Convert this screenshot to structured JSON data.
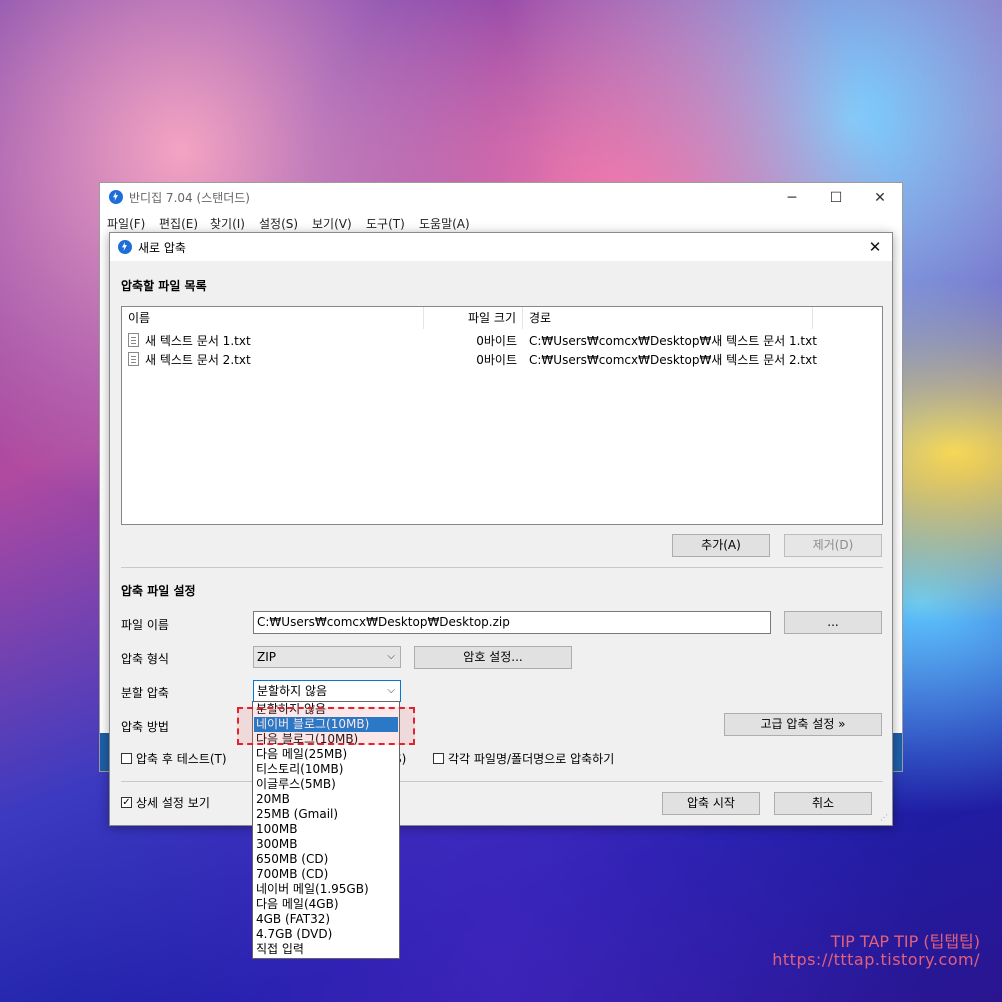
{
  "watermark": {
    "line1": "TIP TAP TIP (팁탭팁)",
    "line2": "https://tttap.tistory.com/"
  },
  "main_window": {
    "title": "반디집 7.04 (스탠더드)",
    "controls": {
      "minimize": "─",
      "maximize": "☐",
      "close": "✕"
    },
    "menu": [
      "파일(F)",
      "편집(E)",
      "찾기(I)",
      "설정(S)",
      "보기(V)",
      "도구(T)",
      "도움말(A)"
    ]
  },
  "dialog": {
    "title": "새로 압축",
    "close": "✕",
    "file_list_label": "압축할 파일 목록",
    "columns": {
      "name": "이름",
      "size": "파일 크기",
      "path": "경로"
    },
    "files": [
      {
        "name": "새 텍스트 문서 1.txt",
        "size": "0바이트",
        "path": "C:₩Users₩comcx₩Desktop₩새 텍스트 문서 1.txt"
      },
      {
        "name": "새 텍스트 문서 2.txt",
        "size": "0바이트",
        "path": "C:₩Users₩comcx₩Desktop₩새 텍스트 문서 2.txt"
      }
    ],
    "add_button": "추가(A)",
    "remove_button": "제거(D)",
    "settings_label": "압축 파일 설정",
    "filename_label": "파일 이름",
    "filename_value": "C:₩Users₩comcx₩Desktop₩Desktop.zip",
    "browse_button": "...",
    "format_label": "압축 형식",
    "format_value": "ZIP",
    "password_button": "암호 설정...",
    "split_label": "분할 압축",
    "split_value": "분할하지 않음",
    "method_label": "압축 방법",
    "advanced_button": "고급 압축 설정 »",
    "test_checkbox": {
      "label": "압축 후 테스트(T)",
      "checked": false
    },
    "hidden_suffix": "S)",
    "each_checkbox": {
      "label": "각각 파일명/폴더명으로 압축하기",
      "checked": false
    },
    "details_checkbox": {
      "label": "상세 설정 보기",
      "checked": true,
      "mark": "✓"
    },
    "start_button": "압축 시작",
    "cancel_button": "취소"
  },
  "split_dropdown": {
    "selected_index": 1,
    "options": [
      "분할하지 않음",
      "네이버 블로그(10MB)",
      "다음 블로그(10MB)",
      "다음 메일(25MB)",
      "티스토리(10MB)",
      "이글루스(5MB)",
      "20MB",
      "25MB (Gmail)",
      "100MB",
      "300MB",
      "650MB (CD)",
      "700MB (CD)",
      "네이버 메일(1.95GB)",
      "다음 메일(4GB)",
      "4GB (FAT32)",
      "4.7GB (DVD)",
      "직접 입력"
    ]
  },
  "colors": {
    "accent": "#0078d7",
    "highlight": "#e3222e",
    "watermark": "#e3607a"
  },
  "icons": {
    "app": "bandizip-logo-icon",
    "file": "text-file-icon"
  }
}
